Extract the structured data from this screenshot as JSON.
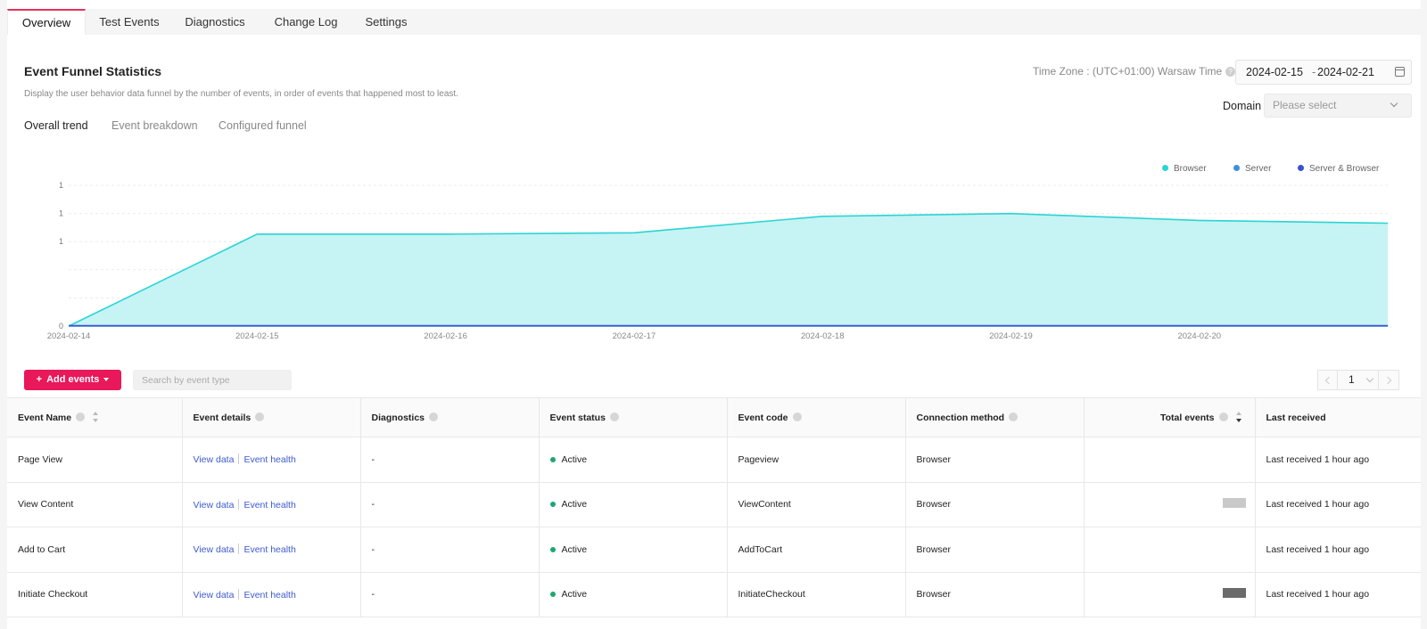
{
  "tabs": [
    {
      "label": "Overview",
      "active": true
    },
    {
      "label": "Test Events",
      "active": false
    },
    {
      "label": "Diagnostics",
      "active": false
    },
    {
      "label": "Change Log",
      "active": false
    },
    {
      "label": "Settings",
      "active": false
    }
  ],
  "header": {
    "title": "Event Funnel Statistics",
    "description": "Display the user behavior data funnel by the number of events, in order of events that happened most to least.",
    "timezone_label": "Time Zone : (UTC+01:00) Warsaw Time",
    "date_start": "2024-02-15",
    "date_sep": "-",
    "date_end": "2024-02-21",
    "domain_label": "Domain",
    "domain_placeholder": "Please select"
  },
  "subtabs": [
    {
      "label": "Overall trend",
      "active": true
    },
    {
      "label": "Event breakdown",
      "active": false
    },
    {
      "label": "Configured funnel",
      "active": false
    }
  ],
  "chart_data": {
    "type": "area",
    "x": [
      "2024-02-14",
      "2024-02-15",
      "2024-02-16",
      "2024-02-17",
      "2024-02-18",
      "2024-02-19",
      "2024-02-20",
      "2024-02-21"
    ],
    "xticks": [
      "2024-02-14",
      "2024-02-15",
      "2024-02-16",
      "2024-02-17",
      "2024-02-18",
      "2024-02-19",
      "2024-02-20"
    ],
    "yticks": [
      "0",
      "",
      "",
      "1",
      "1",
      "1"
    ],
    "series": [
      {
        "name": "Browser",
        "color": "#2ad4d4",
        "values": [
          0,
          0.67,
          0.67,
          0.68,
          0.8,
          0.82,
          0.77,
          0.75
        ]
      },
      {
        "name": "Server",
        "color": "#3d8fe0",
        "values": [
          0,
          0,
          0,
          0,
          0,
          0,
          0,
          0
        ]
      },
      {
        "name": "Server & Browser",
        "color": "#3b4fd6",
        "values": [
          0,
          0,
          0,
          0,
          0,
          0,
          0,
          0
        ]
      }
    ],
    "ylim": [
      0,
      1
    ],
    "grid": true,
    "legend": "top-right"
  },
  "toolbar": {
    "add_label": "Add events",
    "search_placeholder": "Search by event type",
    "page": "1"
  },
  "table": {
    "columns": [
      "Event Name",
      "Event details",
      "Diagnostics",
      "Event status",
      "Event code",
      "Connection method",
      "Total events",
      "Last received"
    ],
    "rows": [
      {
        "name": "Page View",
        "view": "View data",
        "health": "Event health",
        "diag": "-",
        "status": "Active",
        "code": "Pageview",
        "method": "Browser",
        "last": "Last received 1 hour ago"
      },
      {
        "name": "View Content",
        "view": "View data",
        "health": "Event health",
        "diag": "-",
        "status": "Active",
        "code": "ViewContent",
        "method": "Browser",
        "last": "Last received 1 hour ago"
      },
      {
        "name": "Add to Cart",
        "view": "View data",
        "health": "Event health",
        "diag": "-",
        "status": "Active",
        "code": "AddToCart",
        "method": "Browser",
        "last": "Last received 1 hour ago"
      },
      {
        "name": "Initiate Checkout",
        "view": "View data",
        "health": "Event health",
        "diag": "-",
        "status": "Active",
        "code": "InitiateCheckout",
        "method": "Browser",
        "last": "Last received 1 hour ago"
      }
    ]
  }
}
